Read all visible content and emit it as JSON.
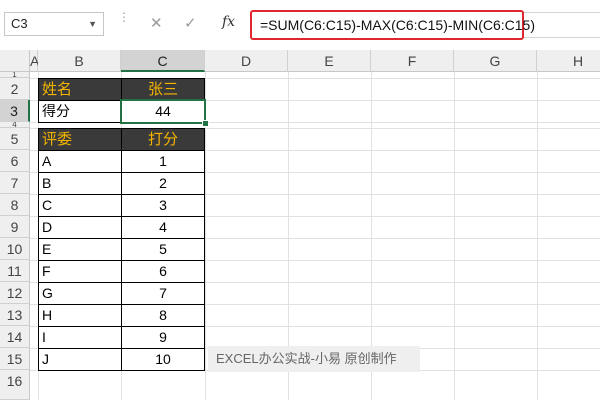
{
  "formula_bar": {
    "name_box": "C3",
    "fx_label": "fx",
    "formula": "=SUM(C6:C15)-MAX(C6:C15)-MIN(C6:C15)"
  },
  "columns": [
    "A",
    "B",
    "C",
    "D",
    "E",
    "F",
    "G",
    "H"
  ],
  "rows": [
    "1",
    "2",
    "3",
    "4",
    "5",
    "6",
    "7",
    "8",
    "9",
    "10",
    "11",
    "12",
    "13",
    "14",
    "15",
    "16"
  ],
  "cells": {
    "B2": "姓名",
    "C2": "张三",
    "B3": "得分",
    "C3": "44",
    "B5": "评委",
    "C5": "打分"
  },
  "judges": [
    {
      "name": "A",
      "score": "1"
    },
    {
      "name": "B",
      "score": "2"
    },
    {
      "name": "C",
      "score": "3"
    },
    {
      "name": "D",
      "score": "4"
    },
    {
      "name": "E",
      "score": "5"
    },
    {
      "name": "F",
      "score": "6"
    },
    {
      "name": "G",
      "score": "7"
    },
    {
      "name": "H",
      "score": "8"
    },
    {
      "name": "I",
      "score": "9"
    },
    {
      "name": "J",
      "score": "10"
    }
  ],
  "watermark": "EXCEL办公实战-小易 原创制作",
  "colors": {
    "header_bg": "#3a3a3a",
    "header_text": "#f5b400",
    "selection": "#217346",
    "formula_highlight": "#e0262f"
  },
  "icons": {
    "name_box_dropdown": "chevron-down-icon",
    "cancel": "close-icon",
    "enter": "check-icon",
    "insert_function": "fx-icon"
  }
}
